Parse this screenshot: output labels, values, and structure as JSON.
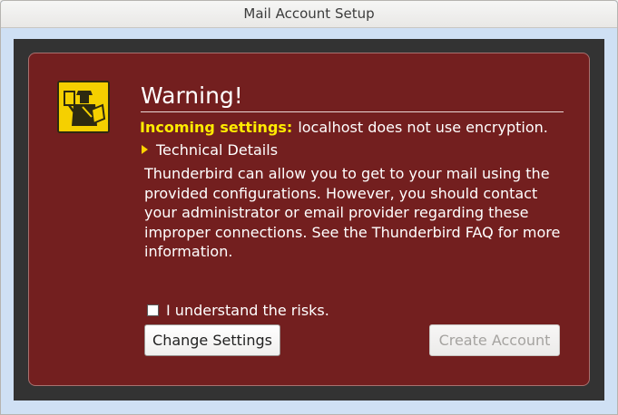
{
  "window": {
    "title": "Mail Account Setup"
  },
  "warning": {
    "icon": "security-officer-warning-icon",
    "heading": "Warning!",
    "incoming_label": "Incoming settings:",
    "incoming_message": "localhost does not use encryption.",
    "technical_details": "Technical Details",
    "body": "Thunderbird can allow you to get to your mail using the provided configurations. However, you should contact your administrator or email provider regarding these improper connections. See the Thunderbird FAQ for more information.",
    "checkbox_label": "I understand the risks.",
    "checkbox_checked": false
  },
  "buttons": {
    "change_settings": "Change Settings",
    "create_account": "Create Account",
    "create_account_enabled": false
  },
  "colors": {
    "panel_background": "#731f1f",
    "label_yellow": "#ffeb00",
    "outer_dark": "#333333"
  }
}
